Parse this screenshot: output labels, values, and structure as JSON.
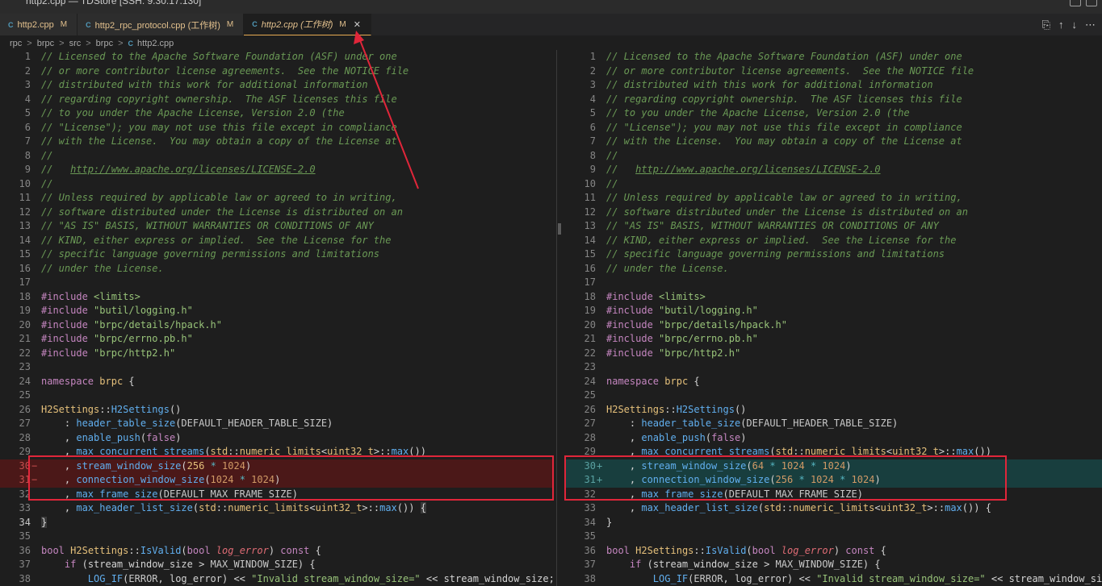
{
  "window": {
    "title": "http2.cpp — TDStore [SSH: 9.30.17.130]"
  },
  "tabs": [
    {
      "icon": "C",
      "label": "http2.cpp",
      "status": "M"
    },
    {
      "icon": "C",
      "label": "http2_rpc_protocol.cpp (工作树)",
      "status": "M"
    },
    {
      "icon": "C",
      "label": "http2.cpp (工作树)",
      "status": "M",
      "close": "✕"
    }
  ],
  "breadcrumb": {
    "items": [
      "rpc",
      "brpc",
      "src",
      "brpc"
    ],
    "file_icon": "C",
    "file": "http2.cpp",
    "separator": ">"
  },
  "editor_actions": {
    "open_changes_icon": "⎘",
    "prev_change_icon": "↑",
    "next_change_icon": "↓",
    "more_icon": "⋯"
  },
  "diff": {
    "line_numbers": [
      "1",
      "2",
      "3",
      "4",
      "5",
      "6",
      "7",
      "8",
      "9",
      "10",
      "11",
      "12",
      "13",
      "14",
      "15",
      "16",
      "17",
      "18",
      "19",
      "20",
      "21",
      "22",
      "23",
      "24",
      "25",
      "26",
      "27",
      "28",
      "29",
      "30",
      "31",
      "32",
      "33",
      "34",
      "35",
      "36",
      "37",
      "38"
    ],
    "license": [
      "// Licensed to the Apache Software Foundation (ASF) under one",
      "// or more contributor license agreements.  See the NOTICE file",
      "// distributed with this work for additional information",
      "// regarding copyright ownership.  The ASF licenses this file",
      "// to you under the Apache License, Version 2.0 (the",
      "// \"License\"); you may not use this file except in compliance",
      "// with the License.  You may obtain a copy of the License at",
      "//",
      "//   ",
      "//",
      "// Unless required by applicable law or agreed to in writing,",
      "// software distributed under the License is distributed on an",
      "// \"AS IS\" BASIS, WITHOUT WARRANTIES OR CONDITIONS OF ANY",
      "// KIND, either express or implied.  See the License for the",
      "// specific language governing permissions and limitations",
      "// under the License."
    ],
    "license_url": "http://www.apache.org/licenses/LICENSE-2.0",
    "include_kw": "#include",
    "includes": [
      "<limits>",
      "\"butil/logging.h\"",
      "\"brpc/details/hpack.h\"",
      "\"brpc/errno.pb.h\"",
      "\"brpc/http2.h\""
    ],
    "ns_kw": "namespace",
    "ns_name": "brpc",
    "ns_brace": " {",
    "ctor_class": "H2Settings",
    "ctor_sep": "::",
    "ctor_name": "H2Settings",
    "ctor_parens": "()",
    "f_header_table_size": "header_table_size",
    "c_default_header_table_size": "DEFAULT_HEADER_TABLE_SIZE",
    "f_enable_push": "enable_push",
    "v_false": "false",
    "f_max_concurrent_streams": "max_concurrent_streams",
    "std_ns": "std",
    "numeric_limits": "numeric_limits",
    "uint32_t": "uint32_t",
    "max_fn": "max",
    "f_stream_window_size": "stream_window_size",
    "f_connection_window_size": "connection_window_size",
    "f_max_frame_size": "max_frame_size",
    "c_default_max_frame_size": "DEFAULT_MAX_FRAME_SIZE",
    "f_max_header_list_size": "max_header_list_size",
    "n_1024": "1024",
    "left_stream_num": "256",
    "right_stream_num": "64",
    "left_conn_expr_a": "1024",
    "right_conn_expr_a": "256",
    "times": "*",
    "del_marker": "−",
    "ins_marker": "+",
    "closing_brace": "}",
    "bool_kw": "bool",
    "isvalid_class": "H2Settings",
    "isvalid_name": "IsValid",
    "param_log_error": "log_error",
    "const_kw": "const",
    "if_kw": "if",
    "stream_window_size_var": "stream_window_size",
    "max_window_size": "MAX_WINDOW_SIZE",
    "log_if": "LOG_IF",
    "error_kw": "ERROR",
    "invalid_str": "\"Invalid stream_window_size=\"",
    "shift": "<<",
    "line38_tail_left": " stream_window_size;",
    "line38_tail_right": " stream_window_size"
  }
}
